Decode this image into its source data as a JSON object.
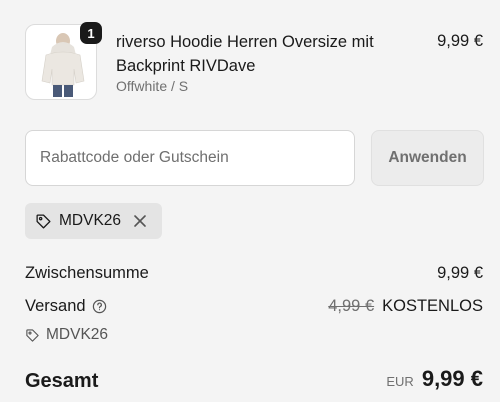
{
  "product": {
    "quantity": "1",
    "title": "riverso Hoodie Herren Oversize mit Backprint RIVDave",
    "variant": "Offwhite / S",
    "price": "9,99 €",
    "image_alt": "hoodie-product-image"
  },
  "discount": {
    "placeholder": "Rabattcode oder Gutschein",
    "value": "",
    "apply_label": "Anwenden"
  },
  "applied_code": {
    "code": "MDVK26",
    "icon": "tag-icon",
    "remove_icon": "close-icon"
  },
  "summary": {
    "subtotal_label": "Zwischensumme",
    "subtotal_value": "9,99 €",
    "shipping_label": "Versand",
    "shipping_help_icon": "question-icon",
    "shipping_old_price": "4,99 €",
    "shipping_new_price": "KOSTENLOS",
    "shipping_code": "MDVK26",
    "total_label": "Gesamt",
    "currency": "EUR",
    "total_value": "9,99 €"
  },
  "colors": {
    "background": "#f4f4f4",
    "text": "#1a1a1a",
    "muted": "#707070",
    "chip": "#e4e4e4"
  }
}
